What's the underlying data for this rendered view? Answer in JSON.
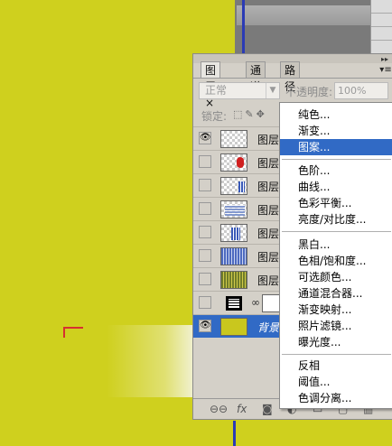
{
  "panel": {
    "tabs": [
      {
        "label": "图层",
        "close": "×"
      },
      {
        "label": "通道"
      },
      {
        "label": "路径"
      }
    ],
    "blend_mode": "正常",
    "opacity_label": "不透明度:",
    "opacity_value": "100%",
    "lock_label": "锁定:",
    "layers": [
      {
        "name": "图层",
        "thumb": "t1",
        "visible": true
      },
      {
        "name": "图层",
        "thumb": "t2",
        "visible": false
      },
      {
        "name": "图层",
        "thumb": "t3",
        "visible": false
      },
      {
        "name": "图层",
        "thumb": "t4",
        "visible": false
      },
      {
        "name": "图层",
        "thumb": "t5",
        "visible": false
      },
      {
        "name": "图层",
        "thumb": "t6",
        "visible": false
      },
      {
        "name": "图层",
        "thumb": "t7",
        "visible": false
      },
      {
        "name": "",
        "thumb": "adj",
        "visible": false
      },
      {
        "name": "背景",
        "thumb": "bg",
        "visible": true
      }
    ],
    "footer_icons": [
      "link-icon",
      "fx-icon",
      "mask-icon",
      "adjustment-icon",
      "group-icon",
      "new-layer-icon",
      "trash-icon"
    ]
  },
  "menu": {
    "group1": [
      "纯色...",
      "渐变...",
      "图案..."
    ],
    "highlighted": "图案...",
    "group2": [
      "色阶...",
      "曲线...",
      "色彩平衡...",
      "亮度/对比度..."
    ],
    "group3": [
      "黑白...",
      "色相/饱和度...",
      "可选颜色...",
      "通道混合器...",
      "渐变映射...",
      "照片滤镜...",
      "曝光度..."
    ],
    "group4": [
      "反相",
      "阈值...",
      "色调分离..."
    ]
  },
  "colors": {
    "canvas": "#cfd01e",
    "selection": "#316ac5",
    "panel": "#d4d0c8"
  }
}
